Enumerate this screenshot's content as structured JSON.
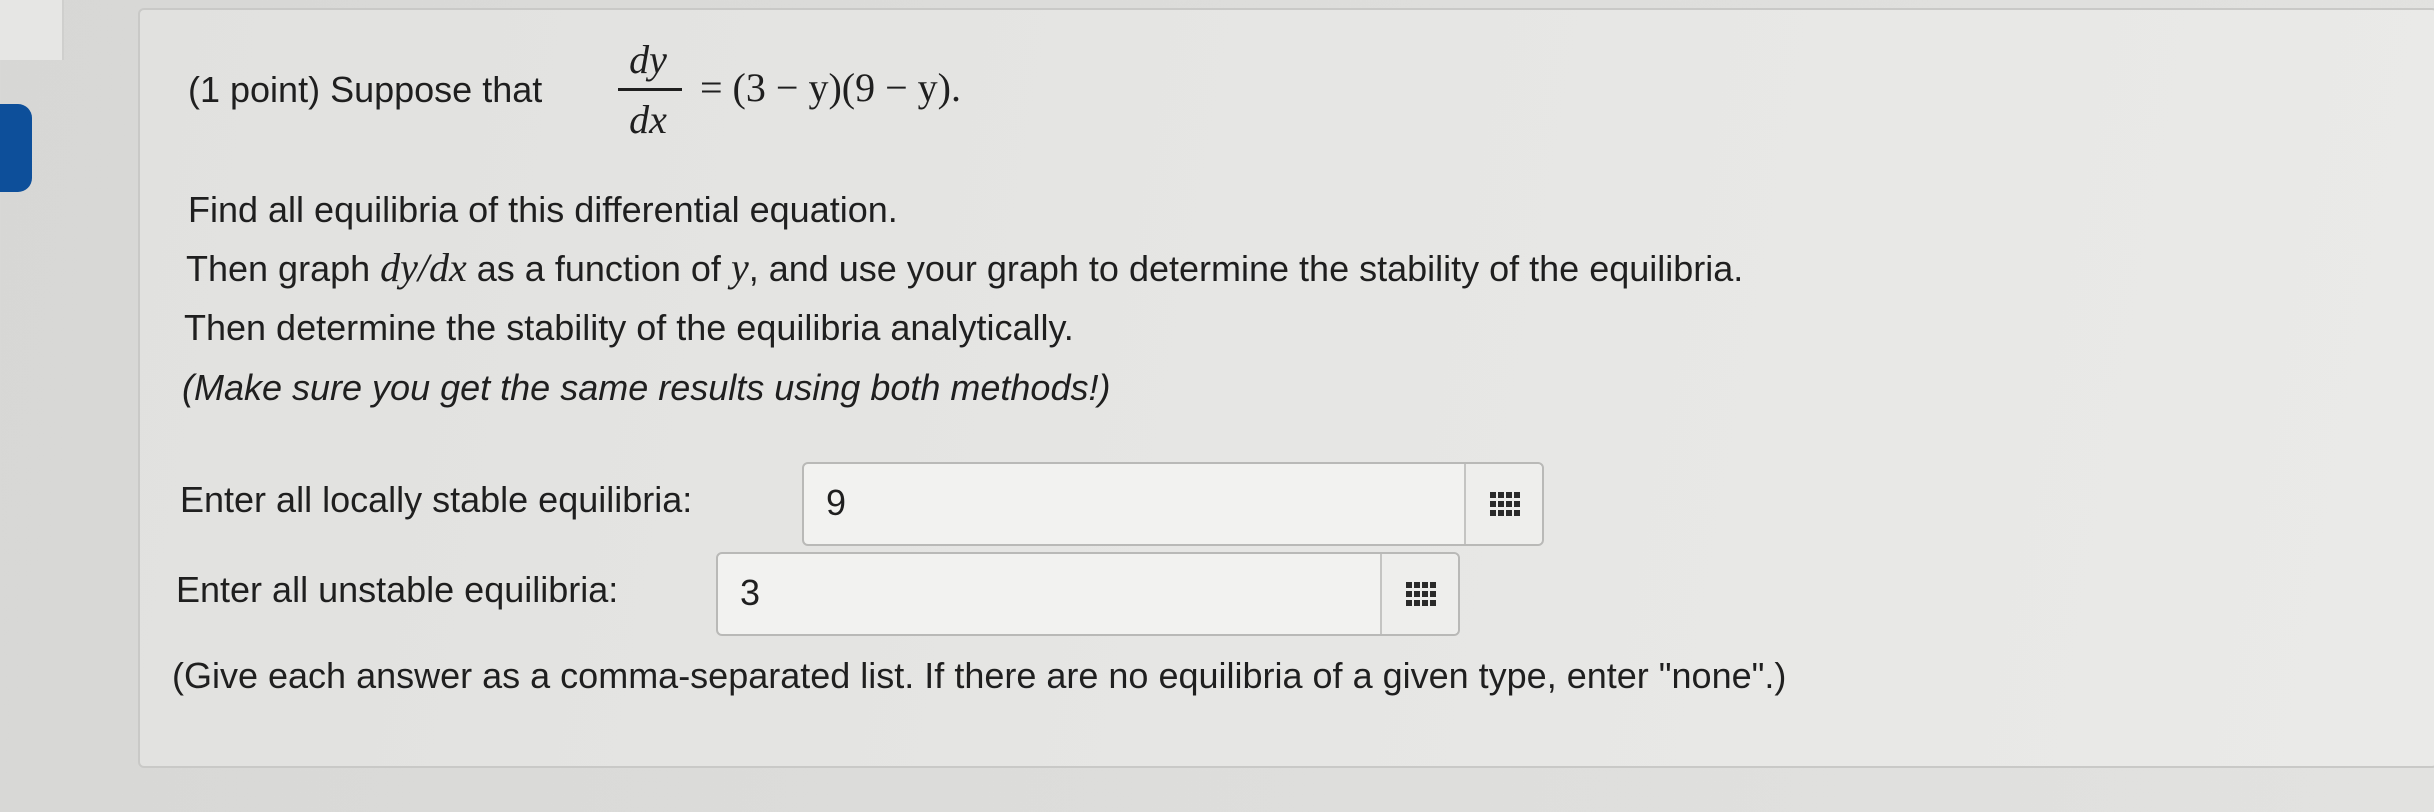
{
  "problem": {
    "intro": "(1 point) Suppose that",
    "fraction_numerator": "dy",
    "fraction_denominator": "dx",
    "equation_rhs": "= (3 − y)(9 − y).",
    "line1": "Find all equilibria of this differential equation.",
    "line2_part1": "Then graph ",
    "line2_math": "dy/dx",
    "line2_part2": " as a function of ",
    "line2_var": "y",
    "line2_part3": ", and use your graph to determine the stability of the equilibria.",
    "line3": "Then determine the stability of the equilibria analytically.",
    "line4": "(Make sure you get the same results using both methods!)"
  },
  "answers": {
    "stable_label": "Enter all locally stable equilibria:",
    "stable_value": "9",
    "unstable_label": "Enter all unstable equilibria:",
    "unstable_value": "3",
    "note": "(Give each answer as a comma-separated list. If there are no equilibria of a given type, enter \"none\".)"
  },
  "icons": {
    "matrix_button": "grid-matrix-icon"
  },
  "colors": {
    "accent": "#0d4f9a"
  }
}
